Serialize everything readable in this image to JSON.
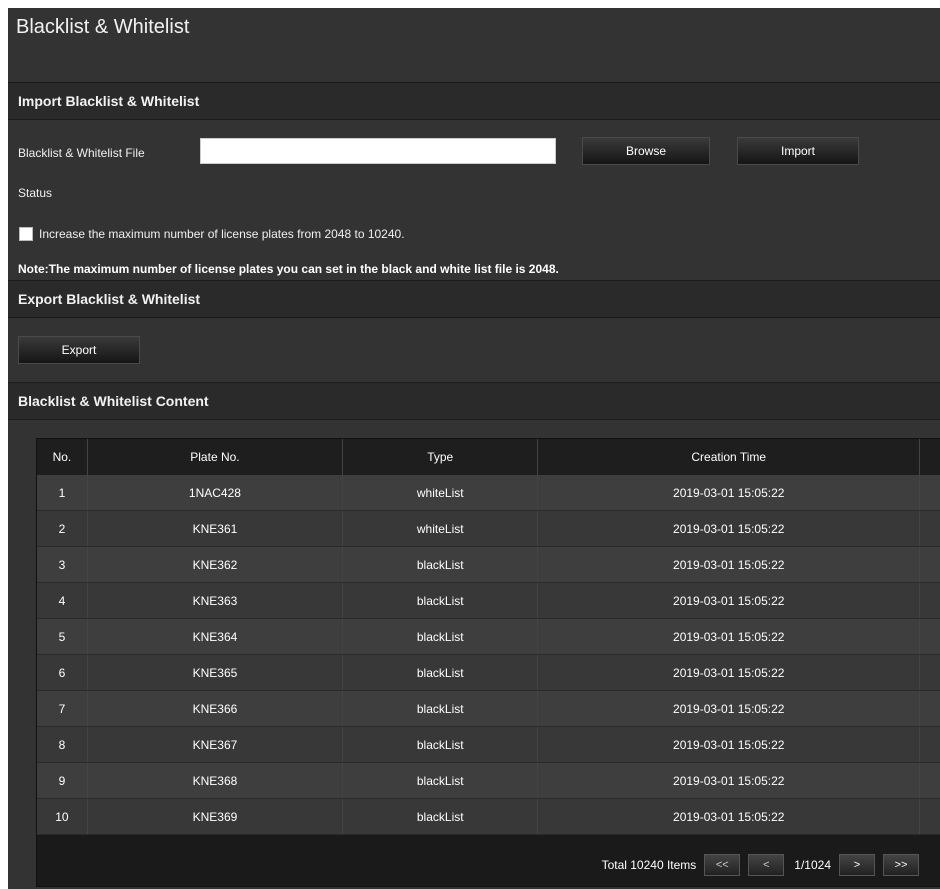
{
  "page": {
    "title": "Blacklist & Whitelist"
  },
  "import_section": {
    "title": "Import Blacklist & Whitelist",
    "file_label": "Blacklist & Whitelist File",
    "file_value": "",
    "browse_label": "Browse",
    "import_label": "Import",
    "status_label": "Status",
    "increase_checkbox_label": "Increase the maximum number of license plates from 2048 to 10240.",
    "increase_checked": false,
    "note": "Note:The maximum number of license plates you can set in the black and white list file is 2048."
  },
  "export_section": {
    "title": "Export Blacklist & Whitelist",
    "export_label": "Export"
  },
  "content_section": {
    "title": "Blacklist & Whitelist Content",
    "columns": [
      "No.",
      "Plate No.",
      "Type",
      "Creation Time",
      ""
    ],
    "rows": [
      {
        "no": "1",
        "plate": "1NAC428",
        "type": "whiteList",
        "time": "2019-03-01 15:05:22"
      },
      {
        "no": "2",
        "plate": "KNE361",
        "type": "whiteList",
        "time": "2019-03-01 15:05:22"
      },
      {
        "no": "3",
        "plate": "KNE362",
        "type": "blackList",
        "time": "2019-03-01 15:05:22"
      },
      {
        "no": "4",
        "plate": "KNE363",
        "type": "blackList",
        "time": "2019-03-01 15:05:22"
      },
      {
        "no": "5",
        "plate": "KNE364",
        "type": "blackList",
        "time": "2019-03-01 15:05:22"
      },
      {
        "no": "6",
        "plate": "KNE365",
        "type": "blackList",
        "time": "2019-03-01 15:05:22"
      },
      {
        "no": "7",
        "plate": "KNE366",
        "type": "blackList",
        "time": "2019-03-01 15:05:22"
      },
      {
        "no": "8",
        "plate": "KNE367",
        "type": "blackList",
        "time": "2019-03-01 15:05:22"
      },
      {
        "no": "9",
        "plate": "KNE368",
        "type": "blackList",
        "time": "2019-03-01 15:05:22"
      },
      {
        "no": "10",
        "plate": "KNE369",
        "type": "blackList",
        "time": "2019-03-01 15:05:22"
      }
    ],
    "pager": {
      "total": "Total 10240 Items",
      "first": "<<",
      "prev": "<",
      "page": "1/1024",
      "next": ">",
      "last": ">>"
    }
  },
  "colors": {
    "panel_bg": "#333333",
    "header_bg": "#2a2a2a",
    "table_bg": "#1a1a1a"
  }
}
